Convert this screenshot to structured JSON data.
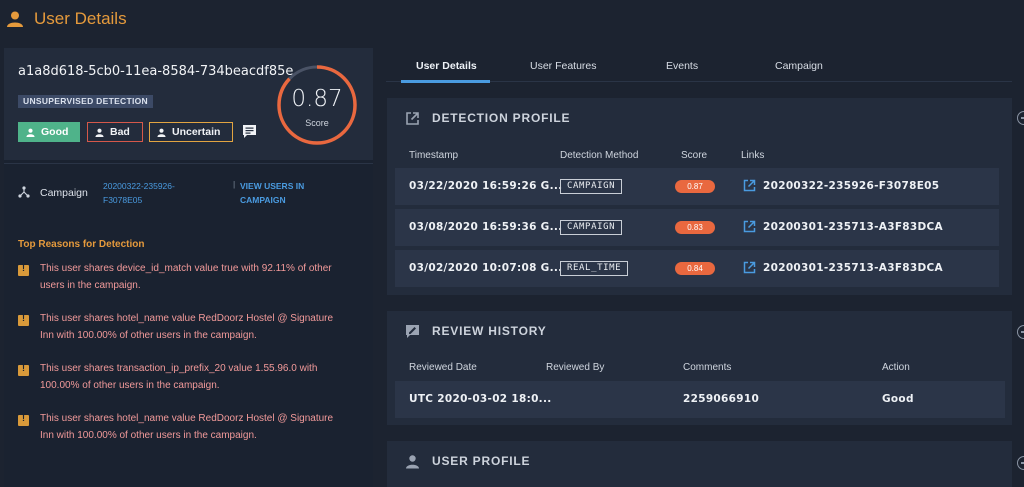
{
  "header": {
    "title": "User Details"
  },
  "user": {
    "id": "a1a8d618-5cb0-11ea-8584-734beacdf85e",
    "detection_badge": "UNSUPERVISED DETECTION",
    "label_buttons": {
      "good": "Good",
      "bad": "Bad",
      "uncertain": "Uncertain"
    },
    "score": {
      "value": "0.87",
      "label": "Score",
      "fraction": 0.87
    }
  },
  "campaign": {
    "label": "Campaign",
    "id_line1": "20200322-235926-",
    "id_line2": "F3078E05",
    "separator": "|",
    "view_users_line1": "VIEW USERS IN",
    "view_users_line2": "CAMPAIGN"
  },
  "reasons": {
    "title": "Top Reasons for Detection",
    "items": [
      {
        "line1": "This user shares device_id_match value true with 92.11% of other",
        "line2": "users in the campaign."
      },
      {
        "line1": "This user shares hotel_name value RedDoorz Hostel @ Signature",
        "line2": "Inn with 100.00% of other users in the campaign."
      },
      {
        "line1": "This user shares transaction_ip_prefix_20 value 1.55.96.0 with",
        "line2": "100.00% of other users in the campaign."
      },
      {
        "line1": "This user shares hotel_name value RedDoorz Hostel @ Signature",
        "line2": "Inn with 100.00% of other users in the campaign."
      }
    ]
  },
  "tabs": [
    "User Details",
    "User Features",
    "Events",
    "Campaign"
  ],
  "detection_profile": {
    "title": "DETECTION PROFILE",
    "columns": [
      "Timestamp",
      "Detection Method",
      "Score",
      "Links"
    ],
    "rows": [
      {
        "timestamp": "03/22/2020 16:59:26 G...",
        "method": "CAMPAIGN",
        "score": "0.87",
        "link": "20200322-235926-F3078E05"
      },
      {
        "timestamp": "03/08/2020 16:59:36 G...",
        "method": "CAMPAIGN",
        "score": "0.83",
        "link": "20200301-235713-A3F83DCA"
      },
      {
        "timestamp": "03/02/2020 10:07:08 G...",
        "method": "REAL_TIME",
        "score": "0.84",
        "link": "20200301-235713-A3F83DCA"
      }
    ]
  },
  "review_history": {
    "title": "REVIEW HISTORY",
    "columns": [
      "Reviewed Date",
      "Reviewed By",
      "Comments",
      "Action"
    ],
    "rows": [
      {
        "date": "UTC 2020-03-02 18:0...",
        "by": "",
        "comments": "2259066910",
        "action": "Good"
      }
    ]
  },
  "user_profile": {
    "title": "USER PROFILE"
  },
  "colors": {
    "accent_orange": "#e59a3c",
    "link_blue": "#4a9be0",
    "good_green": "#4fb38a",
    "bad_red": "#d6584a",
    "uncertain_yellow": "#e2a441",
    "score_orange": "#e9683f",
    "reason_text": "#f29a9a"
  }
}
